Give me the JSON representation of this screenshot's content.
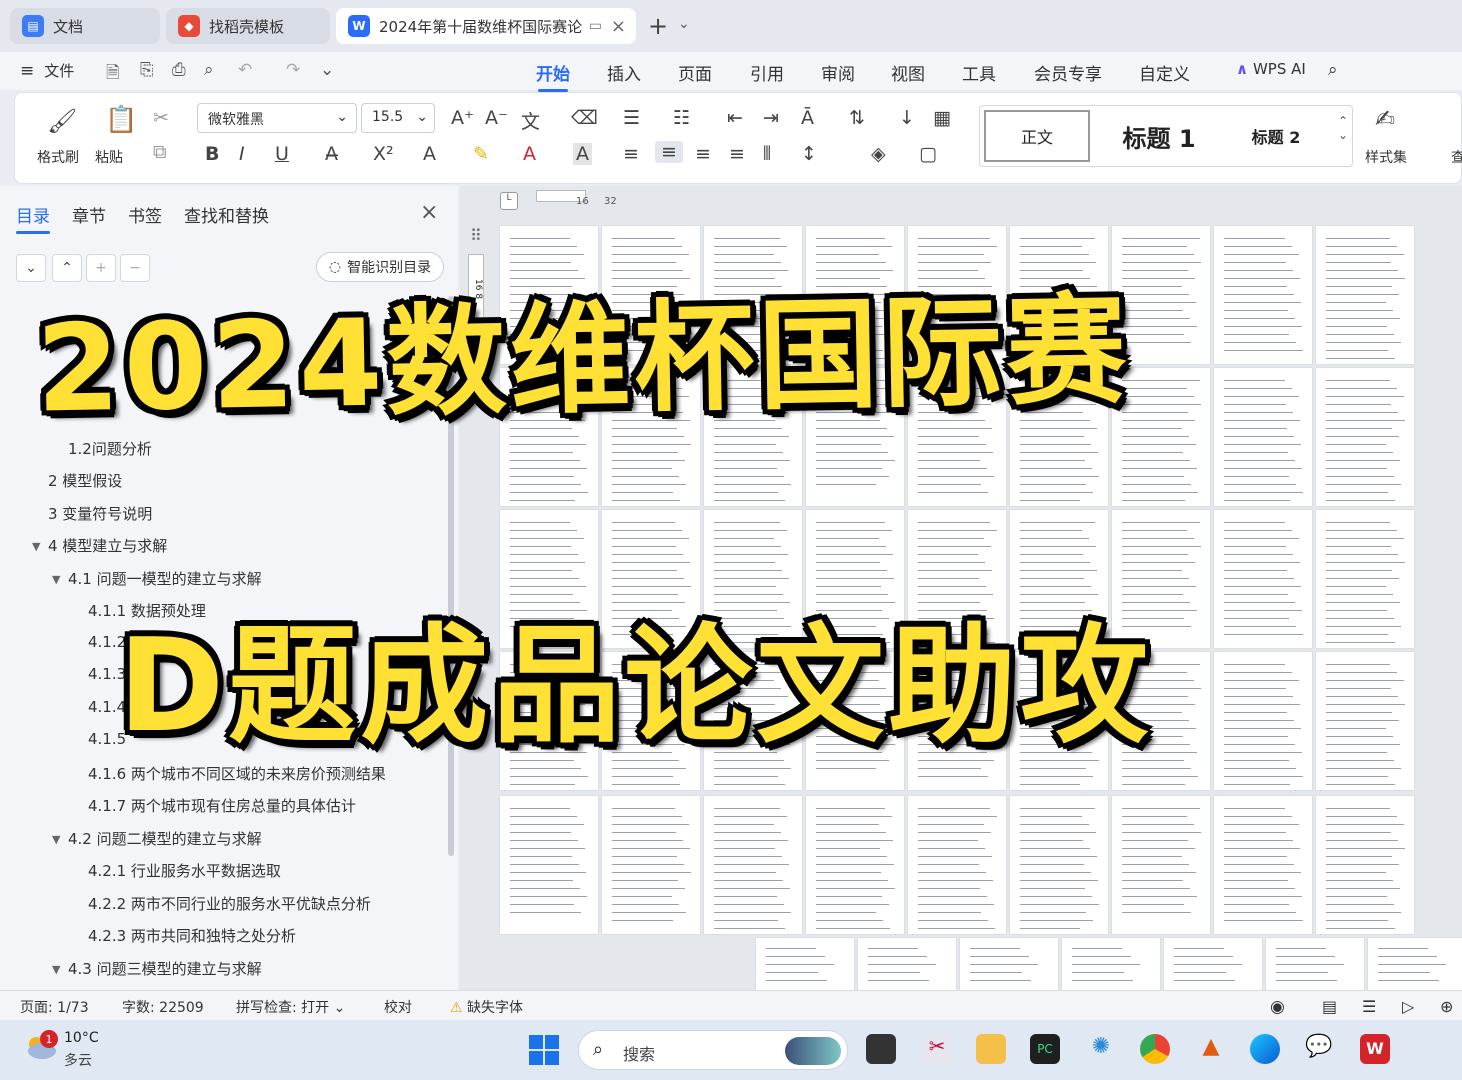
{
  "tabs": {
    "docs_label": "文档",
    "template_label": "找稻壳模板",
    "active_doc_label": "2024年第十届数维杯国际赛论",
    "close_glyph": "×",
    "new_glyph": "+"
  },
  "menu": {
    "file_label": "文件",
    "tabs": [
      "开始",
      "插入",
      "页面",
      "引用",
      "审阅",
      "视图",
      "工具",
      "会员专享",
      "自定义"
    ],
    "wps_ai_label": "WPS AI"
  },
  "ribbon": {
    "format_painter_label": "格式刷",
    "paste_label": "粘贴",
    "font_name": "微软雅黑",
    "font_size": "15.5",
    "style_normal": "正文",
    "style_heading1": "标题 1",
    "style_heading2": "标题 2",
    "style_set_label": "样式集",
    "extra_label": "查"
  },
  "nav": {
    "tabs": [
      "目录",
      "章节",
      "书签",
      "查找和替换"
    ],
    "smart_toc_label": "智能识别目录",
    "toc": [
      "1.2问题分析",
      "2 模型假设",
      "3 变量符号说明",
      "4 模型建立与求解",
      "4.1 问题一模型的建立与求解",
      "4.1.1 数据预处理",
      "4.1.2",
      "4.1.3",
      "4.1.4",
      "4.1.5",
      "4.1.6 两个城市不同区域的未来房价预测结果",
      "4.1.7 两个城市现有住房总量的具体估计",
      "4.2 问题二模型的建立与求解",
      "4.2.1  行业服务水平数据选取",
      "4.2.2  两市不同行业的服务水平优缺点分析",
      "4.2.3  两市共同和独特之处分析",
      "4.3 问题三模型的建立与求解"
    ]
  },
  "ruler": {
    "left_mark": "16",
    "right_mark": "32",
    "vertical_mark": "16  8"
  },
  "overlay": {
    "title_line1": "2024数维杯国际赛",
    "title_line2": "D题成品论文助攻"
  },
  "status": {
    "page": "页面: 1/73",
    "words": "字数: 22509",
    "spellcheck": "拼写检查: 打开",
    "proofread": "校对",
    "missing_font": "缺失字体"
  },
  "taskbar": {
    "temperature": "10°C",
    "weather": "多云",
    "badge_count": "1",
    "search_placeholder": "搜索"
  },
  "colors": {
    "accent": "#2a6cf5",
    "overlay_text": "#ffe135",
    "wps_red": "#d4242a"
  }
}
